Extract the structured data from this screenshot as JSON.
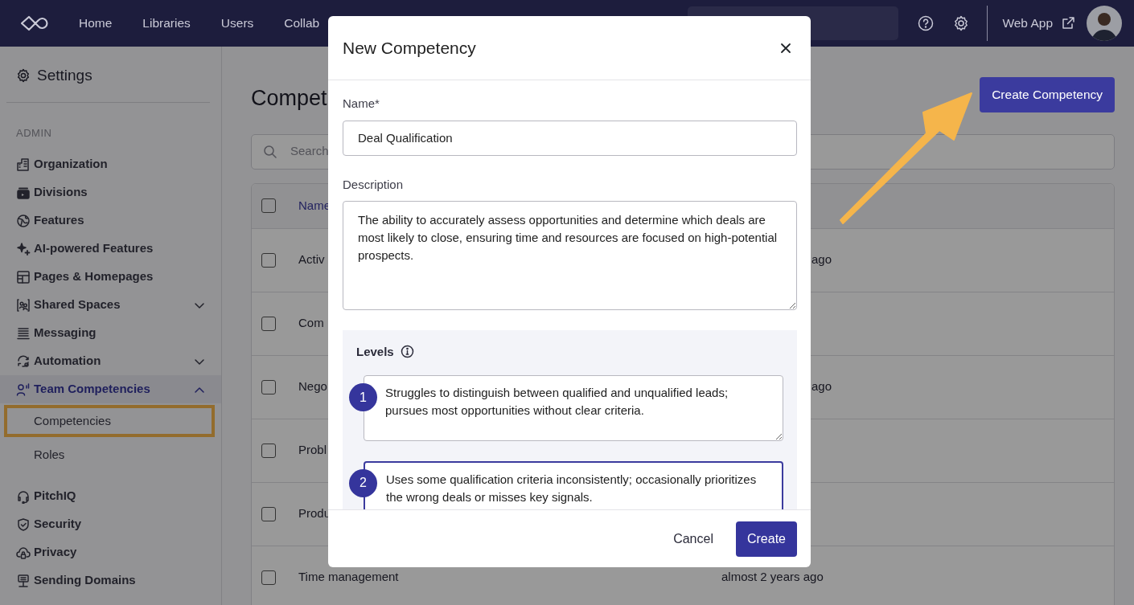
{
  "navbar": {
    "links": [
      "Home",
      "Libraries",
      "Users",
      "Collab"
    ],
    "web_app": "Web App"
  },
  "sidebar": {
    "title": "Settings",
    "section": "ADMIN",
    "items": [
      {
        "label": "Organization",
        "selected": false
      },
      {
        "label": "Divisions",
        "selected": false
      },
      {
        "label": "Features",
        "selected": false
      },
      {
        "label": "AI-powered Features",
        "selected": false
      },
      {
        "label": "Pages & Homepages",
        "selected": false
      },
      {
        "label": "Shared Spaces",
        "selected": false,
        "expanded": false
      },
      {
        "label": "Messaging",
        "selected": false
      },
      {
        "label": "Automation",
        "selected": false,
        "expanded": false
      },
      {
        "label": "Team Competencies",
        "selected": true,
        "expanded": true,
        "children": [
          {
            "label": "Competencies",
            "highlighted": true
          },
          {
            "label": "Roles",
            "highlighted": false
          }
        ]
      },
      {
        "label": "PitchIQ",
        "selected": false
      },
      {
        "label": "Security",
        "selected": false
      },
      {
        "label": "Privacy",
        "selected": false
      },
      {
        "label": "Sending Domains",
        "selected": false
      }
    ]
  },
  "main": {
    "title": "Compet",
    "create_button": "Create Competency",
    "search": {
      "placeholder": "Search"
    },
    "table": {
      "columns": [
        "Name"
      ],
      "header_checked": false,
      "rows": [
        {
          "name": "Activ",
          "updated": "ago",
          "checked": false
        },
        {
          "name": "Com",
          "checked": false
        },
        {
          "name": "Nego",
          "updated": "ago",
          "checked": false
        },
        {
          "name": "Probl",
          "checked": false
        },
        {
          "name": "Produ",
          "checked": false
        },
        {
          "name": "Time management",
          "updated": "almost 2 years ago",
          "checked": false
        }
      ]
    }
  },
  "modal": {
    "title": "New Competency",
    "name_label": "Name*",
    "name_value": "Deal Qualification",
    "description_label": "Description",
    "description_value": "The ability to accurately assess opportunities and determine which deals are most likely to close, ensuring time and resources are focused on high-potential prospects.",
    "levels_label": "Levels",
    "levels": [
      {
        "number": "1",
        "text": "Struggles to distinguish between qualified and unqualified leads; pursues most opportunities without clear criteria.",
        "focused": false
      },
      {
        "number": "2",
        "text": "Uses some qualification criteria inconsistently; occasionally prioritizes the wrong deals or misses key signals.",
        "focused": true
      }
    ],
    "buttons": {
      "cancel": "Cancel",
      "create": "Create"
    }
  }
}
